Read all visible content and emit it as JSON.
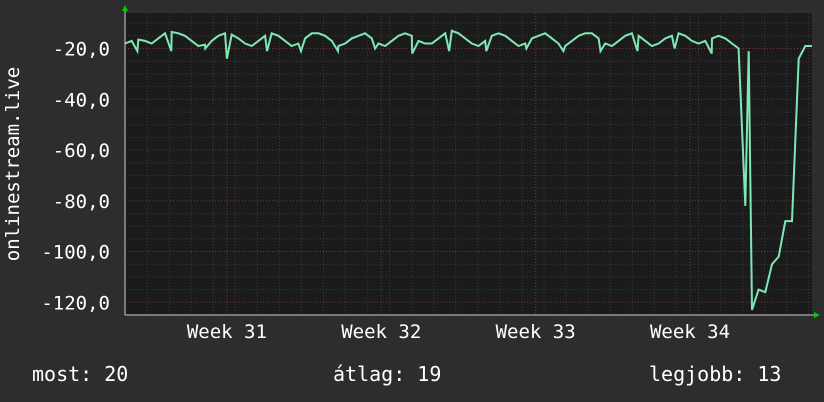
{
  "chart_data": {
    "type": "line",
    "title": "",
    "ylabel": "onlinestream.live",
    "xlabel": "",
    "ylim": [
      -125,
      -6
    ],
    "x_ticks": [
      "Week 31",
      "Week 32",
      "Week 33",
      "Week 34"
    ],
    "y_ticks": [
      "-20,0",
      "-40,0",
      "-60,0",
      "-80,0",
      "-100,0",
      "-120,0"
    ],
    "y_tick_values": [
      -20,
      -40,
      -60,
      -80,
      -100,
      -120
    ],
    "grid": true,
    "colors": {
      "background": "#2d2d2d",
      "plot_background": "#1b1b1b",
      "line": "#7ee8b4",
      "grid_major": "#6e3a3a",
      "axis_arrow": "#00cc00"
    },
    "series": [
      {
        "values": [
          -18,
          -17,
          -16.5,
          -17,
          -18,
          -16,
          -14,
          -13.5,
          -14,
          -15,
          -17,
          -19,
          -18.5,
          -17,
          -15,
          -14,
          -14.5,
          -16,
          -18,
          -19,
          -17,
          -15,
          -14,
          -15,
          -17,
          -19,
          -18,
          -16,
          -14,
          -14,
          -15,
          -17,
          -19,
          -18,
          -16,
          -15,
          -14,
          -16,
          -18,
          -19,
          -17,
          -15,
          -14,
          -15,
          -17,
          -18,
          -18,
          -16,
          -14,
          -13,
          -14,
          -16,
          -18,
          -19,
          -17,
          -15,
          -14,
          -15,
          -17,
          -19,
          -18,
          -16,
          -15,
          -14,
          -16,
          -18,
          -19,
          -17,
          -15,
          -14,
          -14,
          -16,
          -18,
          -19,
          -17,
          -15,
          -14,
          -15,
          -17,
          -19,
          -18,
          -16,
          -15,
          -14,
          -15,
          -17,
          -18,
          -17,
          -16,
          -15,
          -16,
          -18,
          -20,
          -82,
          -123,
          -115,
          -116,
          -105,
          -102,
          -88,
          -88,
          -24,
          -19,
          -19
        ],
        "x_start": 0,
        "x_end": 4.45,
        "x_ticks_at": [
          0.66,
          1.66,
          2.66,
          3.66
        ],
        "dips": [
          {
            "x": 0.08,
            "y": -21
          },
          {
            "x": 0.3,
            "y": -21
          },
          {
            "x": 0.52,
            "y": -20
          },
          {
            "x": 0.66,
            "y": -24
          },
          {
            "x": 0.92,
            "y": -21
          },
          {
            "x": 1.14,
            "y": -21
          },
          {
            "x": 1.38,
            "y": -21
          },
          {
            "x": 1.62,
            "y": -20
          },
          {
            "x": 1.86,
            "y": -22
          },
          {
            "x": 2.1,
            "y": -21
          },
          {
            "x": 2.34,
            "y": -21
          },
          {
            "x": 2.6,
            "y": -20
          },
          {
            "x": 2.84,
            "y": -21
          },
          {
            "x": 3.08,
            "y": -21
          },
          {
            "x": 3.32,
            "y": -21
          },
          {
            "x": 3.56,
            "y": -20
          },
          {
            "x": 3.8,
            "y": -22
          },
          {
            "x": 4.04,
            "y": -21
          }
        ]
      }
    ]
  },
  "legend": {
    "current": "most: 20",
    "average": "átlag: 19",
    "best": "legjobb: 13"
  }
}
